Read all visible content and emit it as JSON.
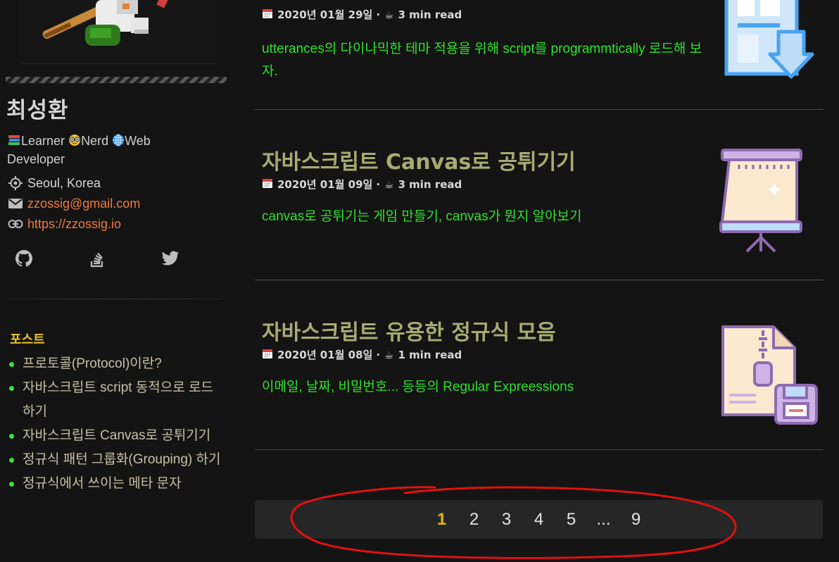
{
  "profile": {
    "name": "최성환",
    "bio_learner": "Learner",
    "bio_nerd": "Nerd",
    "bio_web": "Web Developer",
    "location": "Seoul, Korea",
    "email": "zzossig@gmail.com",
    "website": "https://zzossig.io",
    "social": [
      "github-icon",
      "stackoverflow-icon",
      "twitter-icon"
    ]
  },
  "nav": {
    "title": "포스트",
    "items": [
      "프로토콜(Protocol)이란?",
      "자바스크립트 script 동적으로 로드하기",
      "자바스크립트 Canvas로 공튀기기",
      "정규식 패턴 그룹화(Grouping) 하기",
      "정규식에서 쓰이는 메타 문자"
    ]
  },
  "posts": [
    {
      "date": "2020년 01월 29일",
      "read": "3 min read",
      "excerpt": "utterances의 다이나믹한 테마 적용을 위해 script를 programmtically 로드해 보자.",
      "icon": "download-window-icon"
    },
    {
      "title": "자바스크립트 Canvas로 공튀기기",
      "date": "2020년 01월 09일",
      "read": "3 min read",
      "excerpt": "canvas로 공튀기는 게임 만들기, canvas가 뭔지 알아보기",
      "icon": "canvas-easel-icon"
    },
    {
      "title": "자바스크립트 유용한 정규식 모음",
      "date": "2020년 01월 08일",
      "read": "1 min read",
      "excerpt": "이메일, 날짜, 비밀번호... 등등의 Regular Expreessions",
      "icon": "zip-file-save-icon"
    }
  ],
  "pagination": {
    "pages": [
      "1",
      "2",
      "3",
      "4",
      "5",
      "...",
      "9"
    ],
    "current": "1"
  },
  "colors": {
    "background": "#141414",
    "title": "#a7ab72",
    "excerpt": "#2ee02e",
    "link": "#f07a3c",
    "nav_title": "#e8c22a",
    "current_page": "#e0b515",
    "annotation": "#e01010"
  }
}
